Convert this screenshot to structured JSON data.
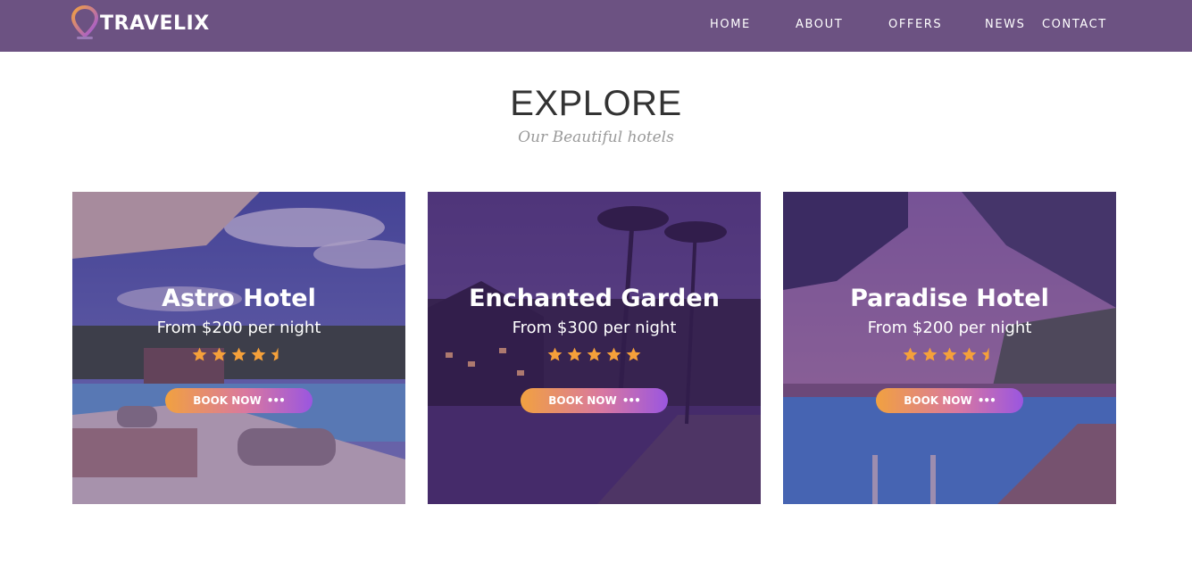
{
  "header": {
    "logo_text": "TRAVELIX",
    "nav": [
      "HOME",
      "ABOUT",
      "OFFERS",
      "NEWS",
      "CONTACT"
    ]
  },
  "section": {
    "title": "EXPLORE",
    "subtitle": "Our Beautiful hotels"
  },
  "cards": [
    {
      "name": "Astro Hotel",
      "price": "From $200 per night",
      "rating": 4.5,
      "button": "BOOK NOW"
    },
    {
      "name": "Enchanted Garden",
      "price": "From $300 per night",
      "rating": 5,
      "button": "BOOK NOW"
    },
    {
      "name": "Paradise Hotel",
      "price": "From $200 per night",
      "rating": 4.5,
      "button": "BOOK NOW"
    }
  ],
  "colors": {
    "navbar": "#6c5282",
    "star": "#f5a03a",
    "button_start": "#f1a140",
    "button_end": "#9a56e0"
  }
}
